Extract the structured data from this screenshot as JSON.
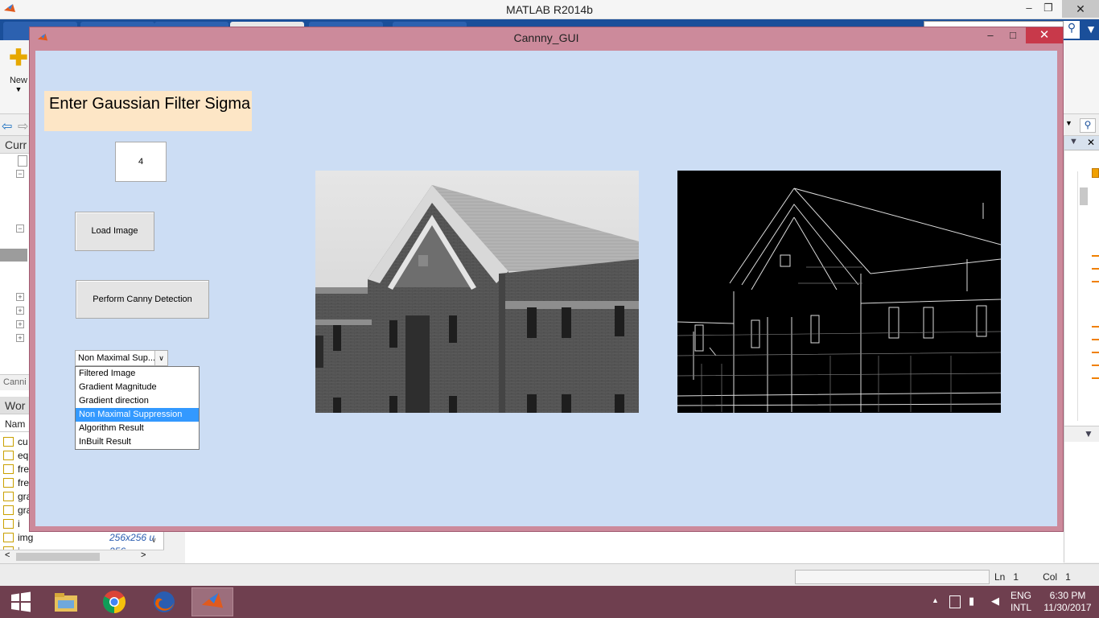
{
  "matlab": {
    "title": "MATLAB R2014b",
    "new_label": "New",
    "panels": {
      "current_folder": "Curr",
      "command_history": "Canni",
      "workspace": "Wor",
      "name_col": "Nam"
    },
    "workspace_rows": [
      {
        "name": "cu",
        "value": ""
      },
      {
        "name": "eq",
        "value": ""
      },
      {
        "name": "fre",
        "value": ""
      },
      {
        "name": "fre",
        "value": ""
      },
      {
        "name": "gra",
        "value": ""
      },
      {
        "name": "gra",
        "value": ""
      },
      {
        "name": "i",
        "value": ""
      },
      {
        "name": "img",
        "value": "256x256 u"
      },
      {
        "name": "i",
        "value": "256"
      }
    ],
    "status": {
      "ln_label": "Ln",
      "ln": "1",
      "col_label": "Col",
      "col": "1"
    }
  },
  "gui": {
    "title": "Cannny_GUI",
    "sigma_label": "Enter Gaussian Filter Sigma",
    "sigma_value": "4",
    "load_button": "Load Image",
    "canny_button": "Perform Canny Detection",
    "select_value": "Non Maximal Sup...",
    "options": [
      "Filtered Image",
      "Gradient Magnitude",
      "Gradient direction",
      "Non Maximal Suppression",
      "Algorithm Result",
      "InBuilt Result"
    ],
    "selected_index": 3
  },
  "taskbar": {
    "lang1": "ENG",
    "lang2": "INTL",
    "time": "6:30 PM",
    "date": "11/30/2017"
  },
  "colors": {
    "gui_bg": "#ccddf4",
    "gui_frame": "#cc8a9b",
    "sigma_label_bg": "#fde6c6",
    "selection": "#3399ff",
    "taskbar": "#6f3f4f"
  }
}
